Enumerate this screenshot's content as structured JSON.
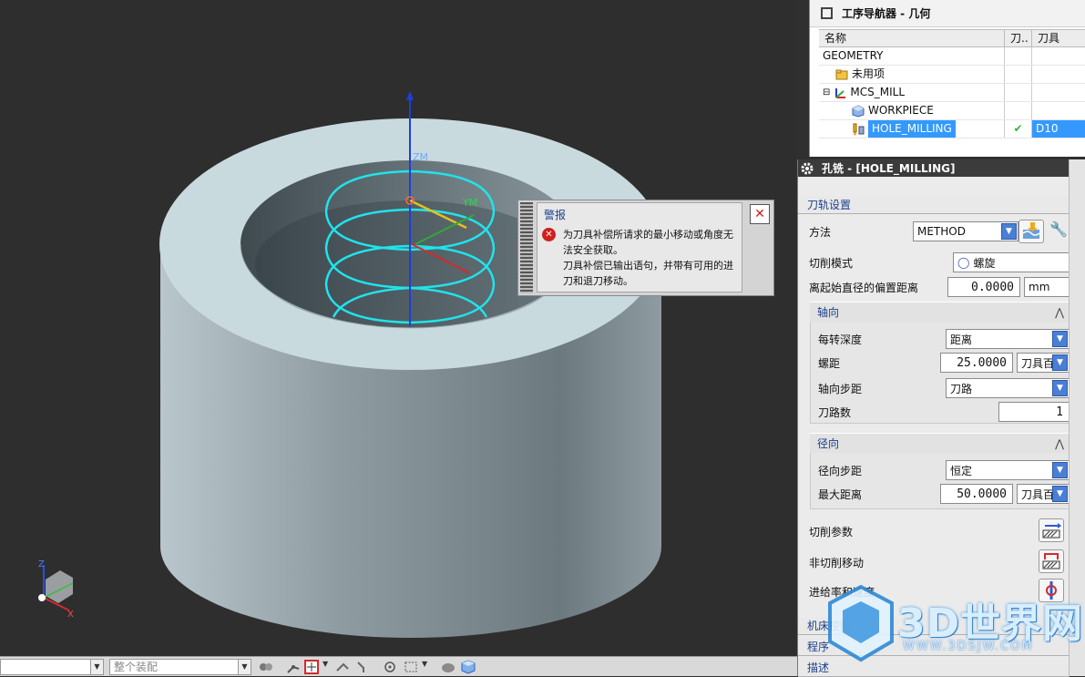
{
  "viewport": {
    "axis_zm": "ZM",
    "axis_ym": "YM",
    "triad": {
      "z": "Z",
      "x": "X"
    }
  },
  "navigator": {
    "title": "工序导航器 - 几何",
    "columns": [
      "名称",
      "刀..",
      "刀具"
    ],
    "rows": [
      {
        "name": "GEOMETRY",
        "icon": "none",
        "check": "",
        "tool": ""
      },
      {
        "name": "未用项",
        "icon": "folder-icon",
        "check": "",
        "tool": ""
      },
      {
        "name": "MCS_MILL",
        "icon": "mcs-icon",
        "check": "",
        "tool": ""
      },
      {
        "name": "WORKPIECE",
        "icon": "workpiece-icon",
        "check": "",
        "tool": ""
      },
      {
        "name": "HOLE_MILLING",
        "icon": "operation-icon",
        "check": "✔",
        "tool": "D10"
      }
    ]
  },
  "dialog": {
    "title": "孔铣 - [HOLE_MILLING]",
    "section": "刀轨设置",
    "method_label": "方法",
    "method_value": "METHOD",
    "cut_mode_label": "切削模式",
    "cut_mode_value": "螺旋",
    "offset_label": "离起始直径的偏置距离",
    "offset_value": "0.0000",
    "offset_unit": "mm",
    "axial": {
      "title": "轴向",
      "depth_per_rev_label": "每转深度",
      "depth_per_rev_value": "距离",
      "pitch_label": "螺距",
      "pitch_value": "25.0000",
      "pitch_unit": "刀具百",
      "axial_step_label": "轴向步距",
      "axial_step_value": "刀路",
      "passes_label": "刀路数",
      "passes_value": "1"
    },
    "radial": {
      "title": "径向",
      "radial_step_label": "径向步距",
      "radial_step_value": "恒定",
      "max_dist_label": "最大距离",
      "max_dist_value": "50.0000",
      "max_dist_unit": "刀具百"
    },
    "cut_params_label": "切削参数",
    "non_cut_label": "非切削移动",
    "feeds_label": "进给率和速度",
    "machine_ctrl_label": "机床控制",
    "program_label": "程序",
    "description_label": "描述"
  },
  "warning": {
    "title": "警报",
    "line1": "为刀具补偿所请求的最小移动或角度无法安全获取。",
    "line2": "刀具补偿已输出语句，并带有可用的进刀和退刀移动。",
    "close": "✕"
  },
  "toolbar": {
    "assembly_filter": "整个装配"
  },
  "watermark": {
    "brand": "3D世界网",
    "url": "WWW.3DSJW.COM"
  },
  "colors": {
    "toolpath": "#21e3ec",
    "accent": "#3399ff",
    "dialog_title_bg": "#3b3b3b"
  }
}
